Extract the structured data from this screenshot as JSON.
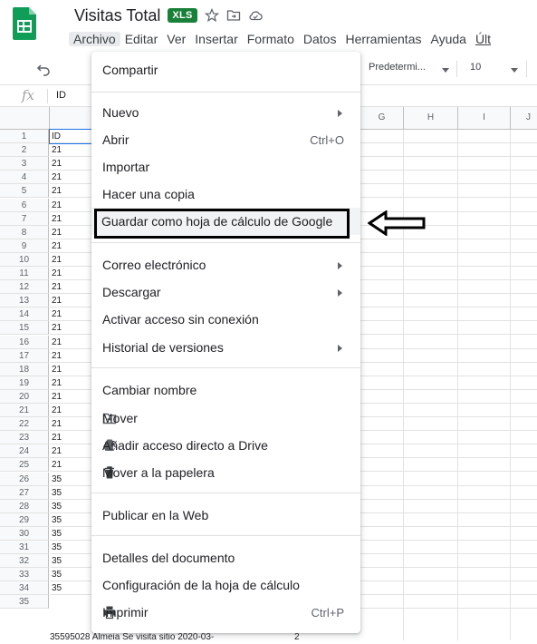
{
  "header": {
    "title": "Visitas Total",
    "badge": "XLS",
    "icons": [
      "star-icon",
      "move-to-folder-icon",
      "cloud-status-icon"
    ]
  },
  "menubar": {
    "items": [
      "Archivo",
      "Editar",
      "Ver",
      "Insertar",
      "Formato",
      "Datos",
      "Herramientas",
      "Ayuda",
      "Últ"
    ]
  },
  "toolbar": {
    "font": "Predetermi...",
    "size": "10"
  },
  "formula_bar": {
    "fx": "fx",
    "value": "ID"
  },
  "grid": {
    "columns": [
      "G",
      "H",
      "I",
      "J"
    ],
    "rows": [
      "1",
      "2",
      "3",
      "4",
      "5",
      "6",
      "7",
      "8",
      "9",
      "10",
      "11",
      "12",
      "13",
      "14",
      "15",
      "16",
      "17",
      "18",
      "19",
      "20",
      "21",
      "22",
      "23",
      "24",
      "25",
      "26",
      "27",
      "28",
      "29",
      "30",
      "31",
      "32",
      "33",
      "34",
      "35"
    ],
    "colA": [
      "ID",
      "21",
      "21",
      "21",
      "21",
      "21",
      "21",
      "21",
      "21",
      "21",
      "21",
      "21",
      "21",
      "21",
      "21",
      "21",
      "21",
      "21",
      "21",
      "21",
      "21",
      "21",
      "21",
      "21",
      "21",
      "35",
      "35",
      "35",
      "35",
      "35",
      "35",
      "35",
      "35",
      "35"
    ],
    "row35_text": "35595028 Almeia Se visita sitio 2020-03-",
    "row35_num": "2"
  },
  "menu": {
    "items": [
      {
        "label": "Compartir"
      },
      {
        "label": "Nuevo",
        "submenu": true
      },
      {
        "label": "Abrir",
        "shortcut": "Ctrl+O"
      },
      {
        "label": "Importar"
      },
      {
        "label": "Hacer una copia"
      },
      {
        "label": "Guardar como hoja de cálculo de Google"
      },
      {
        "label": "Correo electrónico",
        "submenu": true
      },
      {
        "label": "Descargar",
        "submenu": true
      },
      {
        "label": "Activar acceso sin conexión"
      },
      {
        "label": "Historial de versiones",
        "submenu": true
      },
      {
        "label": "Cambiar nombre"
      },
      {
        "label": "Mover",
        "icon": "move-icon"
      },
      {
        "label": "Añadir acceso directo a Drive",
        "icon": "drive-shortcut-icon"
      },
      {
        "label": "Mover a la papelera",
        "icon": "trash-icon"
      },
      {
        "label": "Publicar en la Web"
      },
      {
        "label": "Detalles del documento"
      },
      {
        "label": "Configuración de la hoja de cálculo"
      },
      {
        "label": "Imprimir",
        "shortcut": "Ctrl+P",
        "icon": "print-icon"
      }
    ]
  }
}
